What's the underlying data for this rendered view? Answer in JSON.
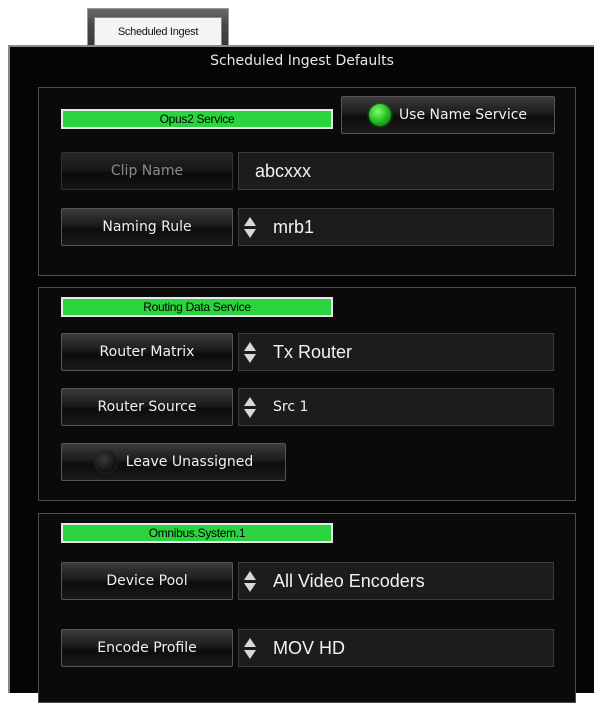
{
  "tab": {
    "label": "Scheduled Ingest"
  },
  "panel": {
    "title": "Scheduled Ingest Defaults"
  },
  "naming": {
    "service_label": "Opus2 Service",
    "use_name_service_label": "Use Name Service",
    "use_name_service_on": true,
    "clip_name_label": "Clip Name",
    "clip_name_value": "abcxxx",
    "naming_rule_label": "Naming Rule",
    "naming_rule_value": "mrb1"
  },
  "routing": {
    "service_label": "Routing Data Service",
    "router_matrix_label": "Router Matrix",
    "router_matrix_value": "Tx Router",
    "router_source_label": "Router Source",
    "router_source_value": "Src 1",
    "leave_unassigned_label": "Leave Unassigned",
    "leave_unassigned_on": false
  },
  "device": {
    "service_label": "Omnibus.System.1",
    "device_pool_label": "Device Pool",
    "device_pool_value": "All Video Encoders",
    "encode_profile_label": "Encode Profile",
    "encode_profile_value": "MOV HD"
  },
  "colors": {
    "service_green": "#2bd43e",
    "led_green": "#1fb81f",
    "panel_bg": "#050505"
  }
}
